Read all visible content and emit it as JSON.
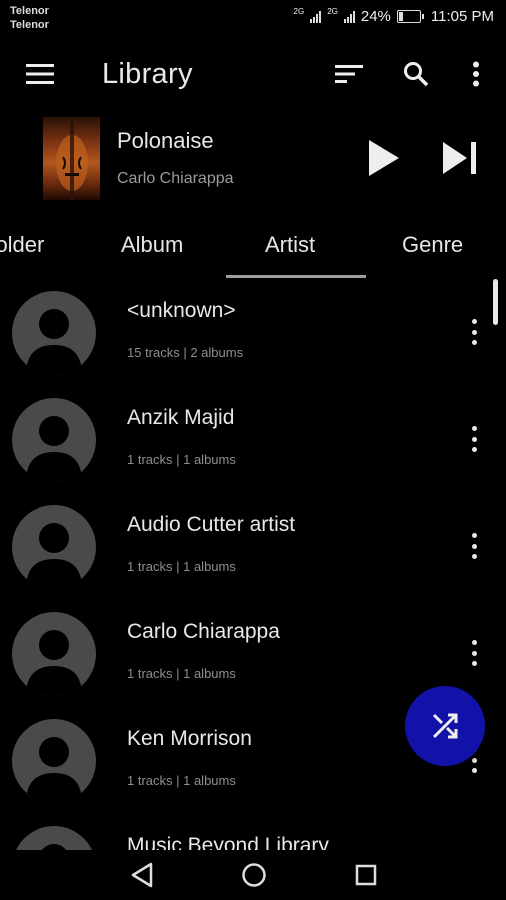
{
  "status_bar": {
    "carrier_1": "Telenor",
    "carrier_2": "Telenor",
    "network_1": "2G",
    "network_2": "2G",
    "battery_text": "24%",
    "battery_level": 0.24,
    "time": "11:05 PM"
  },
  "toolbar": {
    "title": "Library",
    "icons": [
      "menu-icon",
      "sort-icon",
      "search-icon",
      "more-vert-icon"
    ]
  },
  "now_playing": {
    "title": "Polonaise",
    "artist": "Carlo Chiarappa",
    "icons": [
      "play-icon",
      "skip-next-icon"
    ]
  },
  "tabs": {
    "items": [
      {
        "label": "Folder"
      },
      {
        "label": "Album"
      },
      {
        "label": "Artist"
      },
      {
        "label": "Genre"
      }
    ],
    "selected": "Artist"
  },
  "artists": [
    {
      "name": "<unknown>",
      "meta": "15 tracks | 2 albums"
    },
    {
      "name": "Anzik Majid",
      "meta": "1 tracks | 1 albums"
    },
    {
      "name": "Audio Cutter artist",
      "meta": "1 tracks | 1 albums"
    },
    {
      "name": "Carlo Chiarappa",
      "meta": "1 tracks | 1 albums"
    },
    {
      "name": "Ken Morrison",
      "meta": "1 tracks | 1 albums"
    },
    {
      "name": "Music Beyond Library",
      "meta": ""
    }
  ],
  "fab": {
    "icon": "shuffle-icon"
  },
  "nav_bar": {
    "icons": [
      "back-icon",
      "home-icon",
      "recents-icon"
    ]
  },
  "colors": {
    "background": "#000000",
    "fab": "#1212a8",
    "text": "#e8e8e8",
    "secondary_text": "#8e8e8e"
  }
}
